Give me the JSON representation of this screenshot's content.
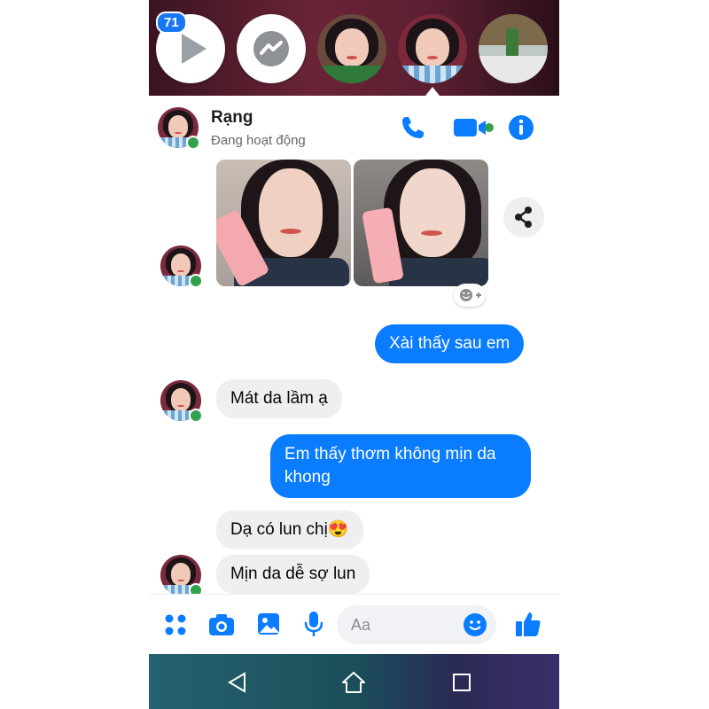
{
  "chat_heads": {
    "badge_count": "71"
  },
  "header": {
    "name": "Rạng",
    "status": "Đang hoạt động"
  },
  "messages": [
    {
      "side": "out",
      "text": "Xài thấy sau em"
    },
    {
      "side": "in",
      "text": "Mát da lầm ạ"
    },
    {
      "side": "out",
      "text": "Em thấy thơm không mịn da khong"
    },
    {
      "side": "in",
      "text": "Dạ có lun chị😍"
    },
    {
      "side": "in",
      "text": "Mịn da dễ sợ lun"
    }
  ],
  "composer": {
    "placeholder": "Aa"
  },
  "colors": {
    "accent": "#0a7cff",
    "online": "#31a24c",
    "incoming_bubble": "#eeeff1"
  },
  "icons": [
    "play-icon",
    "messenger-icon",
    "phone-icon",
    "video-call-icon",
    "info-icon",
    "share-icon",
    "add-reaction-icon",
    "menu-dots-icon",
    "camera-icon",
    "gallery-icon",
    "microphone-icon",
    "emoji-icon",
    "like-icon",
    "back-icon",
    "home-icon",
    "recents-icon"
  ]
}
